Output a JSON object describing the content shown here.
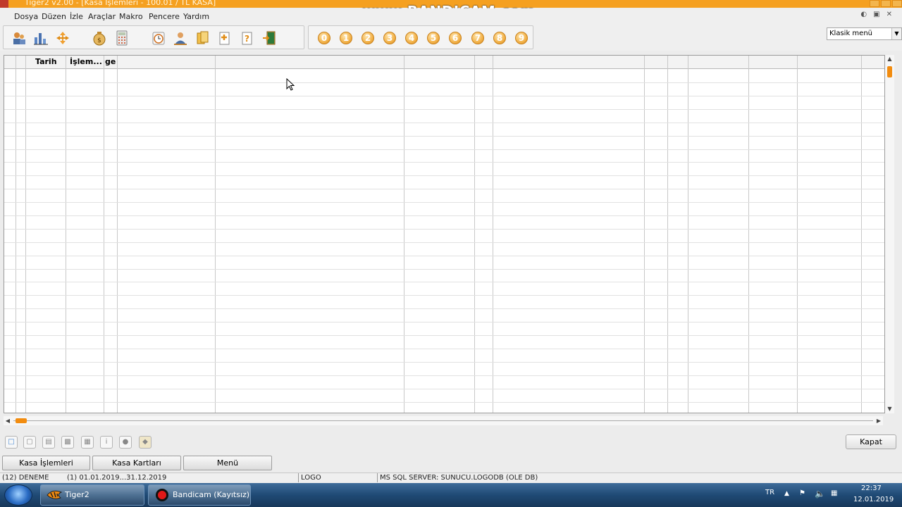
{
  "window": {
    "title": "Tiger2 v2.00 - [Kasa İşlemleri - 100.01 / TL KASA]",
    "watermark": "www.BANDICAM.com"
  },
  "menu": {
    "items": [
      "Dosya",
      "Düzen",
      "İzle",
      "Araçlar",
      "Makro",
      "Pencere",
      "Yardım"
    ]
  },
  "toolbar": {
    "icons": [
      "users-chart-icon",
      "bar-chart-icon",
      "transfer-icon",
      "money-bag-icon",
      "calculator-icon",
      "clock-icon",
      "person-icon",
      "documents-icon",
      "add-document-icon",
      "help-document-icon",
      "exit-door-icon"
    ],
    "number_buttons": [
      "0",
      "1",
      "2",
      "3",
      "4",
      "5",
      "6",
      "7",
      "8",
      "9"
    ],
    "menu_style": "Klasik menü"
  },
  "grid": {
    "headers": [
      "Tarih",
      "İşlem...",
      "ge"
    ]
  },
  "actions": {
    "kapat": "Kapat"
  },
  "tabs": [
    "Kasa İşlemleri",
    "Kasa Kartları",
    "Menü"
  ],
  "status": {
    "company": "(12) DENEME",
    "period": "(1) 01.01.2019...31.12.2019",
    "db": "LOGO",
    "server": "MS SQL SERVER: SUNUCU.LOGODB (OLE DB)"
  },
  "taskbar": {
    "tasks": [
      "Tiger2",
      "Bandicam (Kayıtsız)"
    ],
    "lang": "TR",
    "time": "22:37",
    "date": "12.01.2019"
  },
  "colors": {
    "title_bar": "#f5a020",
    "accent_orange": "#f28c0f",
    "taskbar": "#1f4a75"
  }
}
